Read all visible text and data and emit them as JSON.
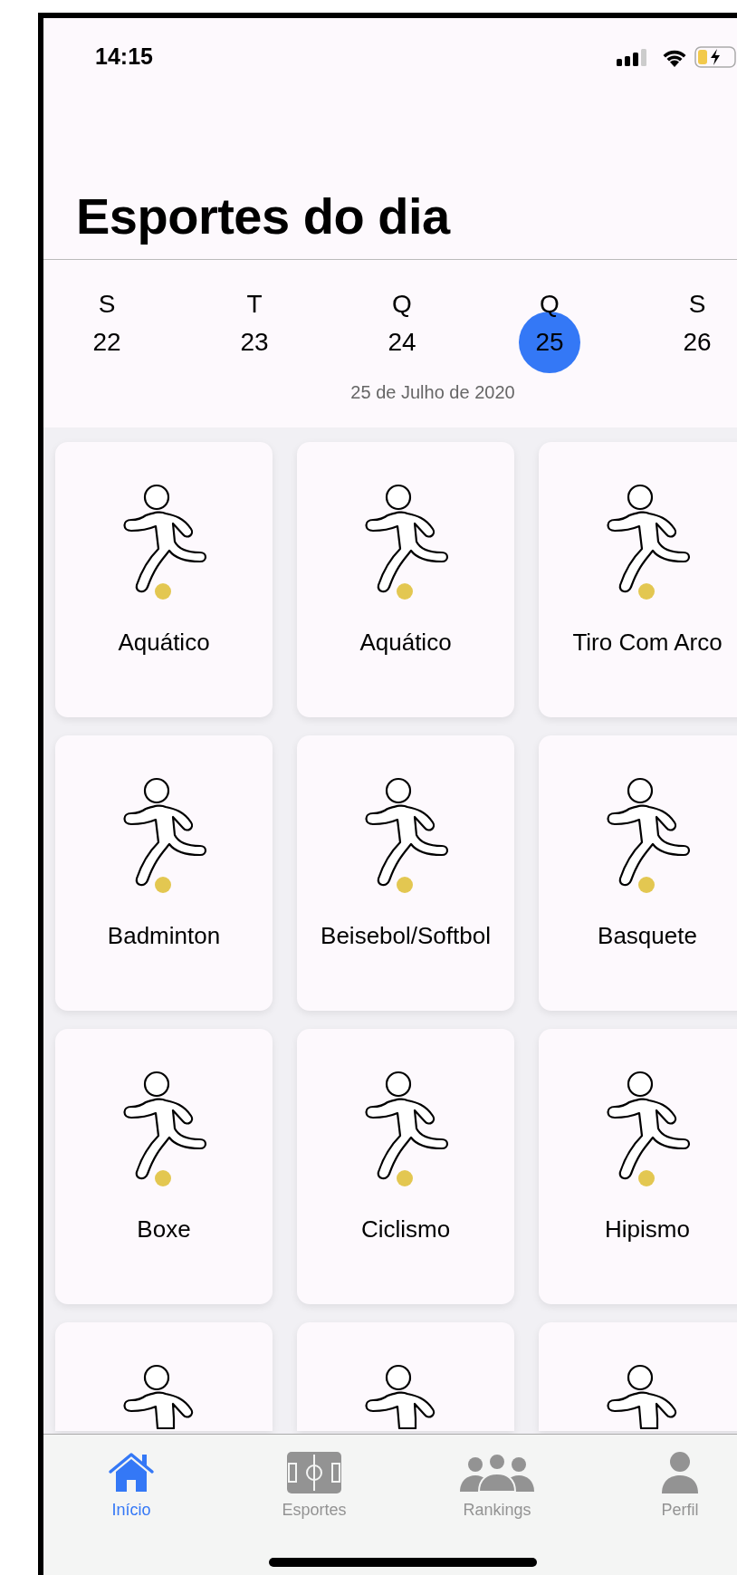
{
  "status_bar": {
    "time": "14:15"
  },
  "title": "Esportes do dia",
  "days": [
    {
      "letter": "S",
      "number": "22",
      "selected": false
    },
    {
      "letter": "T",
      "number": "23",
      "selected": false
    },
    {
      "letter": "Q",
      "number": "24",
      "selected": false
    },
    {
      "letter": "Q",
      "number": "25",
      "selected": true
    },
    {
      "letter": "S",
      "number": "26",
      "selected": false
    }
  ],
  "date_caption": "25 de Julho de 2020",
  "sports": [
    {
      "name": "Aquático"
    },
    {
      "name": "Aquático"
    },
    {
      "name": "Tiro Com Arco"
    },
    {
      "name": "Badminton"
    },
    {
      "name": "Beisebol/Softbol"
    },
    {
      "name": "Basquete"
    },
    {
      "name": "Boxe"
    },
    {
      "name": "Ciclismo"
    },
    {
      "name": "Hipismo"
    },
    {
      "kind": "partial"
    },
    {
      "kind": "partial"
    },
    {
      "kind": "partial"
    }
  ],
  "tabs": [
    {
      "label": "Início",
      "selected": true
    },
    {
      "label": "Esportes",
      "selected": false
    },
    {
      "label": "Rankings",
      "selected": false
    },
    {
      "label": "Perfil",
      "selected": false
    }
  ]
}
